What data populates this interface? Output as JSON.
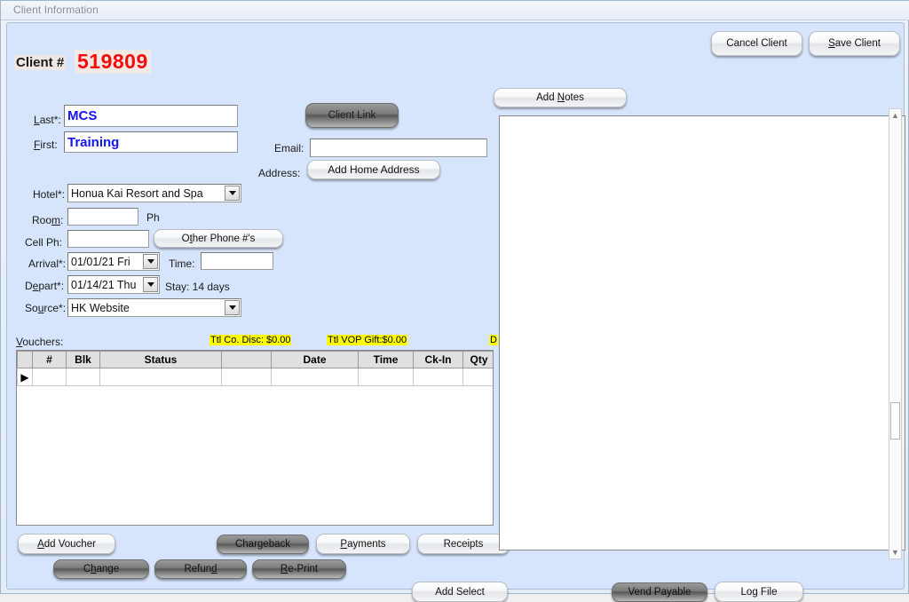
{
  "window": {
    "title": "Client Information"
  },
  "header": {
    "client_label": "Client #",
    "client_number": "519809",
    "client_number_color": "#f60b0b",
    "cancel_button": "Cancel Client",
    "save_button": "Save Client"
  },
  "form": {
    "last_label": "Last*:",
    "last_value": "MCS",
    "first_label": "First:",
    "first_value": "Training",
    "client_link_button": "Client Link",
    "email_label": "Email:",
    "email_value": "",
    "address_label": "Address:",
    "address_button": "Add Home Address",
    "hotel_label": "Hotel*:",
    "hotel_value": "Honua Kai Resort and Spa",
    "room_label": "Room:",
    "room_value": "",
    "ph_label": "Ph",
    "cell_label": "Cell Ph:",
    "cell_value": "",
    "other_phone_button": "Other Phone #'s",
    "arrival_label": "Arrival*:",
    "arrival_value": "01/01/21 Fri",
    "time_label": "Time:",
    "time_value": "",
    "depart_label": "Depart*:",
    "depart_value": "01/14/21 Thu",
    "stay_text": "Stay: 14 days",
    "source_label": "Source*:",
    "source_value": "HK Website"
  },
  "vouchers": {
    "label": "Vouchers:",
    "totals": [
      {
        "text": "Ttl Co. Disc: $0.00"
      },
      {
        "text": "Ttl VOP Gift:$0.00"
      },
      {
        "text": "D"
      }
    ],
    "columns": [
      "",
      "#",
      "Blk",
      "Status",
      "",
      "Date",
      "Time",
      "Ck-In",
      "Qty"
    ],
    "rows": [
      {
        "marker": "▶",
        "num": "",
        "blk": "",
        "status": "",
        "blank": "",
        "date": "",
        "time": "",
        "ckin": "",
        "qty": ""
      }
    ]
  },
  "notes": {
    "add_notes_button": "Add Notes",
    "content": ""
  },
  "actions": {
    "add_voucher": "Add Voucher",
    "chargeback": "Chargeback",
    "payments": "Payments",
    "receipts": "Receipts",
    "change": "Change",
    "refund": "Refund",
    "reprint": "Re-Print",
    "add_select": "Add Select",
    "vend_payable": "Vend Payable",
    "log_file": "Log File"
  },
  "colors": {
    "panel_bg": "#d6e4fc",
    "highlight": "#ffff00",
    "accent_red": "#f60b0b",
    "field_text_blue": "#1414f0"
  }
}
